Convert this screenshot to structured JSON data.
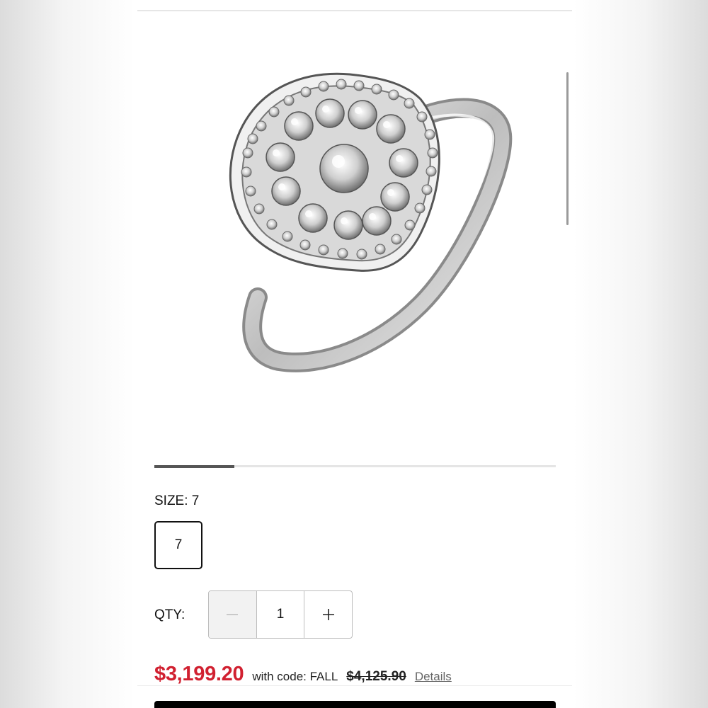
{
  "product": {
    "image_alt": "Pear-shaped diamond halo ring in white gold",
    "carousel_progress": 0.2
  },
  "size": {
    "label": "SIZE:",
    "selected": "7",
    "options": [
      "7"
    ]
  },
  "quantity": {
    "label": "QTY:",
    "value": "1",
    "decrement_icon": "minus-icon",
    "increment_icon": "plus-icon"
  },
  "pricing": {
    "sale_price": "$3,199.20",
    "code_text": "with code: FALL",
    "original_price": "$4,125.90",
    "details_link": "Details"
  },
  "colors": {
    "sale_price": "#d12030",
    "cta_background": "#000000"
  }
}
